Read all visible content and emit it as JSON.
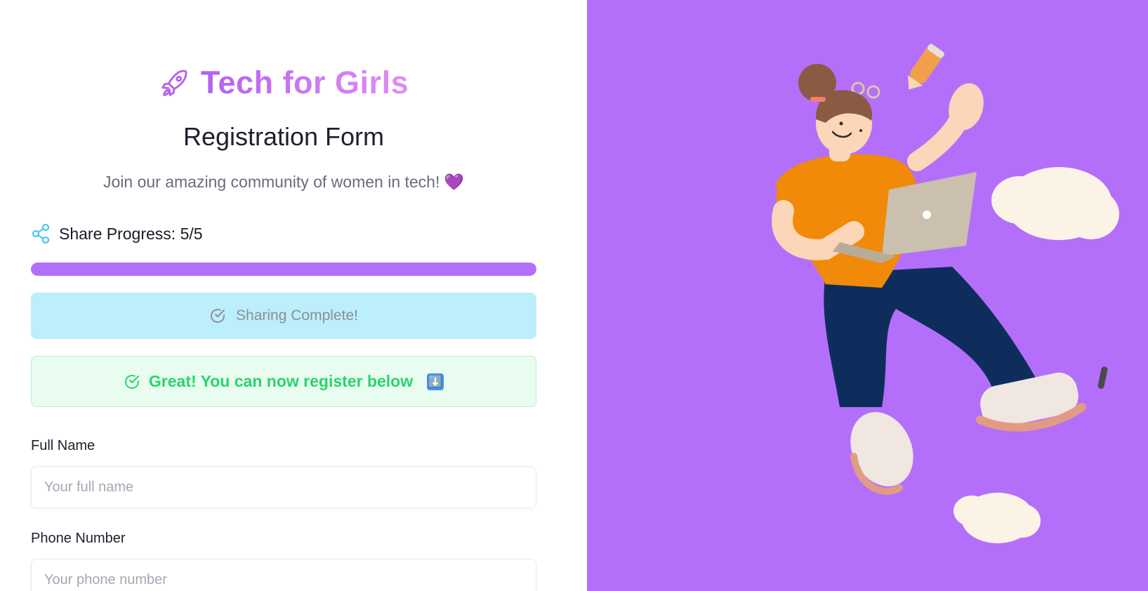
{
  "brand": {
    "title": "Tech for Girls",
    "icon": "rocket-icon"
  },
  "form": {
    "title": "Registration Form",
    "tagline": "Join our amazing community of women in tech!",
    "tagline_emoji": "💜"
  },
  "progress": {
    "label": "Share Progress: 5/5",
    "value": 5,
    "max": 5,
    "fraction": 1.0,
    "icon": "share-icon"
  },
  "share_button": {
    "label": "Sharing Complete!",
    "icon": "check-circle-icon"
  },
  "notice": {
    "text": "Great! You can now register below",
    "emoji": "⬇️",
    "icon": "check-circle-icon"
  },
  "fields": {
    "full_name": {
      "label": "Full Name",
      "placeholder": "Your full name",
      "value": ""
    },
    "phone": {
      "label": "Phone Number",
      "placeholder": "Your phone number",
      "value": ""
    }
  },
  "colors": {
    "accent": "#b46ffa",
    "share_button_bg": "#bdeefc",
    "notice_bg": "#e8fdef",
    "notice_text": "#2bd36e",
    "share_icon": "#4fc3ef"
  },
  "illustration": {
    "icon": "girl-with-laptop-illustration"
  }
}
